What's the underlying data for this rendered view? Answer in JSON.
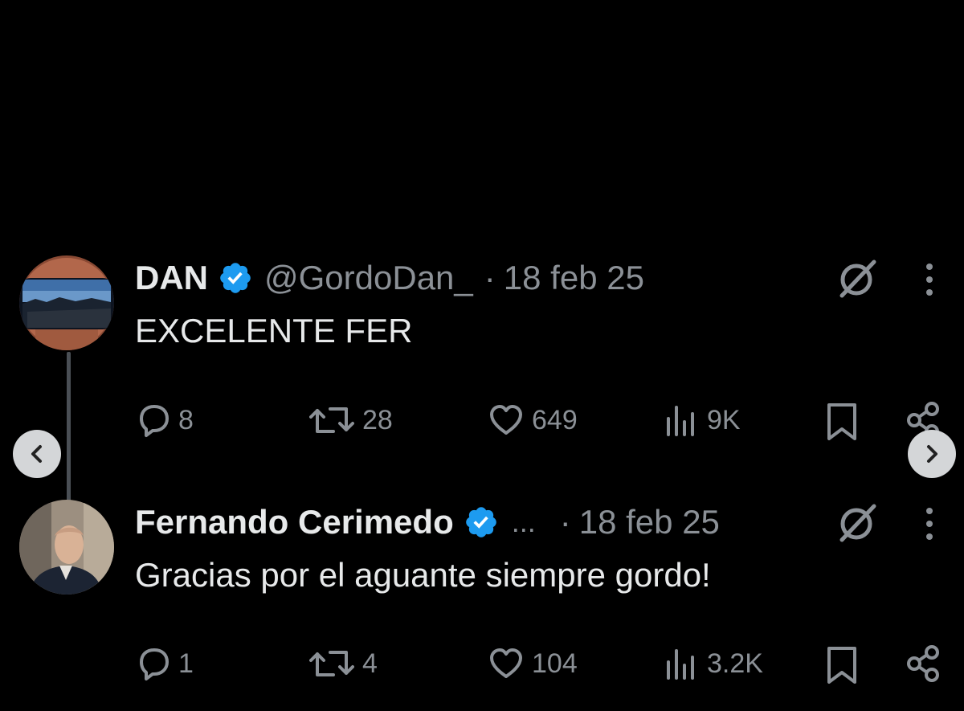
{
  "tweets": [
    {
      "name": "DAN",
      "handle": "@GordoDan_",
      "separator": "·",
      "time": "18 feb 25",
      "text": "EXCELENTE FER",
      "replies": "8",
      "retweets": "28",
      "likes": "649",
      "views": "9K"
    },
    {
      "name": "Fernando Cerimedo",
      "handle": "...",
      "separator": "·",
      "time": "18 feb 25",
      "text": "Gracias por el aguante siempre gordo!",
      "replies": "1",
      "retweets": "4",
      "likes": "104",
      "views": "3.2K"
    }
  ],
  "icons": {
    "verified": "verified-badge-icon",
    "grok": "grok-icon",
    "more": "more-vertical-icon",
    "reply": "reply-bubble-icon",
    "retweet": "retweet-icon",
    "like": "heart-icon",
    "views": "views-bars-icon",
    "bookmark": "bookmark-icon",
    "share": "share-icon",
    "prev": "chevron-left-icon",
    "next": "chevron-right-icon"
  },
  "colors": {
    "background": "#000000",
    "text": "#e7e9ea",
    "muted": "#8b9096",
    "verified": "#1d9bf0"
  }
}
